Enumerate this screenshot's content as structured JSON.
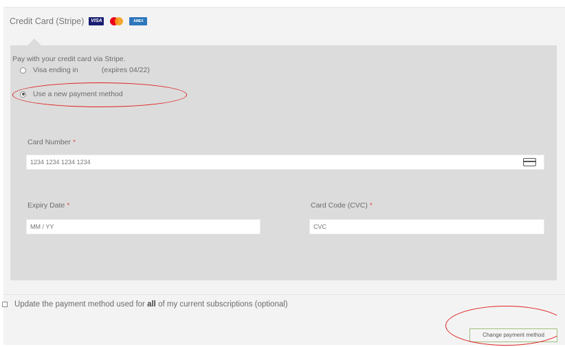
{
  "header": {
    "title": "Credit Card (Stripe)",
    "logos": {
      "visa": "VISA",
      "amex": "AMEX"
    }
  },
  "payment": {
    "intro": "Pay with your credit card via Stripe.",
    "saved_card_prefix": "Visa ending in",
    "saved_card_expires": "(expires 04/22)",
    "new_method_label": "Use a new payment method"
  },
  "fields": {
    "card_number": {
      "label": "Card Number",
      "required_mark": "*",
      "placeholder": "1234 1234 1234 1234"
    },
    "expiry": {
      "label": "Expiry Date",
      "required_mark": "*",
      "placeholder": "MM / YY"
    },
    "cvc": {
      "label": "Card Code (CVC)",
      "required_mark": "*",
      "placeholder": "CVC"
    }
  },
  "update": {
    "before": "Update the payment method used for",
    "emph": "all",
    "after": "of my current subscriptions (optional)"
  },
  "button": {
    "label": "Change payment method"
  },
  "colors": {
    "panel": "#dcdcdc",
    "outer": "#f3f3f3",
    "annotation": "#e02020",
    "required": "#d9534f",
    "button_border": "#9fbf7f"
  }
}
